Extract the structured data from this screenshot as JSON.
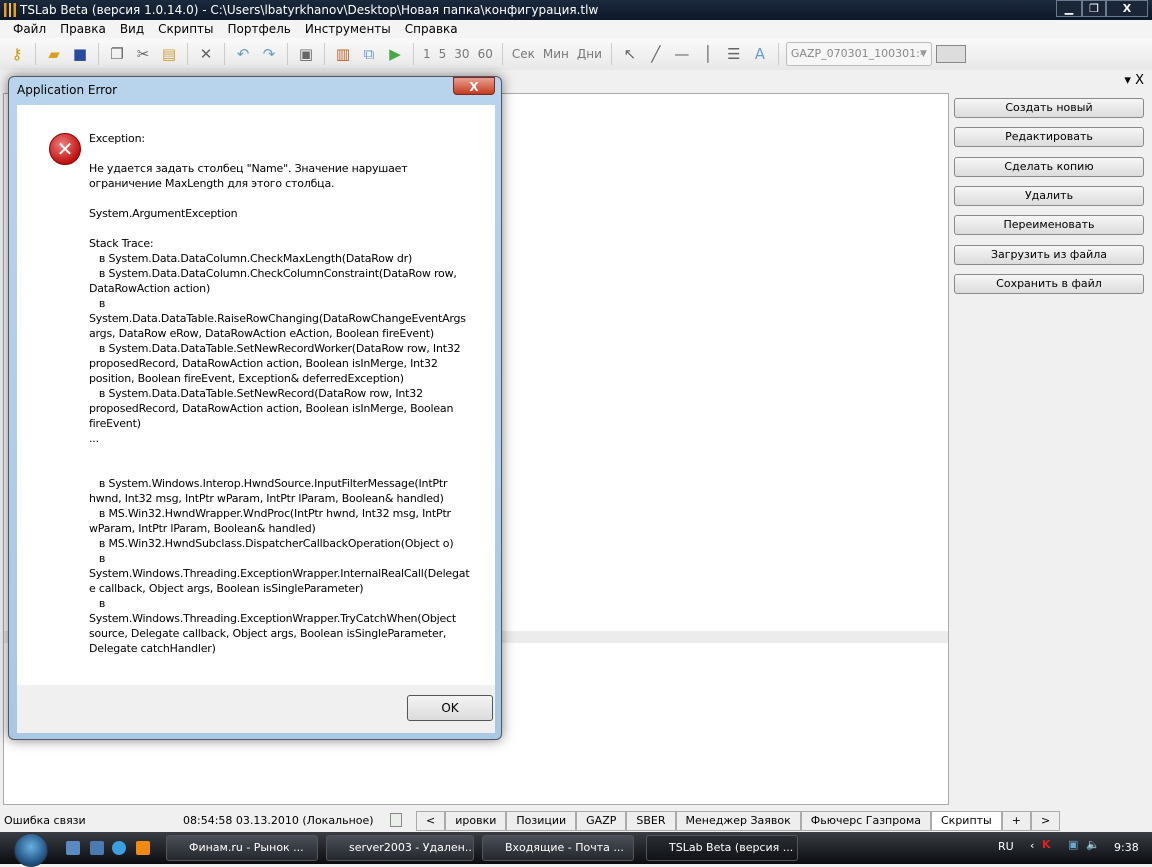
{
  "window": {
    "title": "TSLab Beta (версия 1.0.14.0) - C:\\Users\\lbatyrkhanov\\Desktop\\Новая папка\\конфигурация.tlw",
    "minimize": "▁",
    "restore": "❐",
    "close": "X"
  },
  "menu": [
    "Файл",
    "Правка",
    "Вид",
    "Скрипты",
    "Портфель",
    "Инструменты",
    "Справка"
  ],
  "toolbar": {
    "intervals": [
      "1",
      "5",
      "30",
      "60"
    ],
    "units": [
      "Сек",
      "Мин",
      "Дни"
    ],
    "instrument": "GAZP_070301_100301:-"
  },
  "panel": {
    "controls": "▾ X"
  },
  "right_buttons": [
    "Создать новый",
    "Редактировать",
    "Сделать копию",
    "Удалить",
    "Переименовать",
    "Загрузить из файла",
    "Сохранить в файл"
  ],
  "status": {
    "connection": "Ошибка связи",
    "time": "08:54:58 03.13.2010 (Локальное)"
  },
  "tabs": {
    "prev": "<",
    "items": [
      "ировки",
      "Позиции",
      "GAZP",
      "SBER",
      "Менеджер Заявок",
      "Фьючерс Газпрома",
      "Скрипты"
    ],
    "add": "+",
    "next": ">"
  },
  "taskbar": {
    "tasks": [
      "Финам.ru - Рынок ...",
      "server2003 - Удален...",
      "Входящие - Почта ...",
      "TSLab Beta (версия ..."
    ],
    "lang": "RU",
    "clock": "9:38"
  },
  "dialog": {
    "title": "Application Error",
    "close": "X",
    "message": "Exception:\n\nНе удается задать столбец \"Name\". Значение нарушает\nограничение MaxLength для этого столбца.\n\nSystem.ArgumentException\n\nStack Trace:\n   в System.Data.DataColumn.CheckMaxLength(DataRow dr)\n   в System.Data.DataColumn.CheckColumnConstraint(DataRow row,\nDataRowAction action)\n   в\nSystem.Data.DataTable.RaiseRowChanging(DataRowChangeEventArgs\nargs, DataRow eRow, DataRowAction eAction, Boolean fireEvent)\n   в System.Data.DataTable.SetNewRecordWorker(DataRow row, Int32\nproposedRecord, DataRowAction action, Boolean isInMerge, Int32\nposition, Boolean fireEvent, Exception& deferredException)\n   в System.Data.DataTable.SetNewRecord(DataRow row, Int32\nproposedRecord, DataRowAction action, Boolean isInMerge, Boolean\nfireEvent)\n...\n\n\n   в System.Windows.Interop.HwndSource.InputFilterMessage(IntPtr\nhwnd, Int32 msg, IntPtr wParam, IntPtr lParam, Boolean& handled)\n   в MS.Win32.HwndWrapper.WndProc(IntPtr hwnd, Int32 msg, IntPtr\nwParam, IntPtr lParam, Boolean& handled)\n   в MS.Win32.HwndSubclass.DispatcherCallbackOperation(Object o)\n   в\nSystem.Windows.Threading.ExceptionWrapper.InternalRealCall(Delegat\ne callback, Object args, Boolean isSingleParameter)\n   в\nSystem.Windows.Threading.ExceptionWrapper.TryCatchWhen(Object\nsource, Delegate callback, Object args, Boolean isSingleParameter,\nDelegate catchHandler)",
    "ok": "OK"
  }
}
